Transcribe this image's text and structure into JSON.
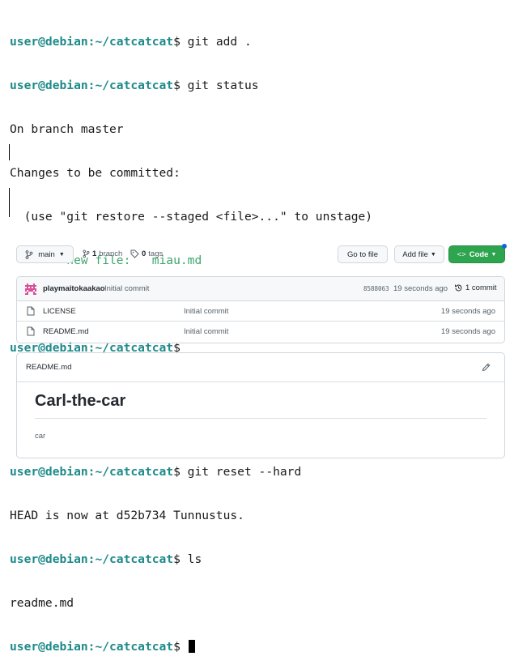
{
  "terminal": {
    "user_host": "user@debian",
    "path": ":~/catcatcat",
    "prompt_sign": "$",
    "lines": {
      "cmd1": " git add .",
      "cmd2": " git status",
      "out1": "On branch master",
      "out2": "Changes to be committed:",
      "out3": "  (use \"git restore --staged <file>...\" to unstage)",
      "out4": "        new file:   miau.md",
      "cmd4": " git reset --hard",
      "out5": "HEAD is now at d52b734 Tunnustus.",
      "cmd5": " ls",
      "out6": "readme.md"
    }
  },
  "github": {
    "branch_button": "main",
    "branch_count": "1",
    "branch_label": "branch",
    "tag_count": "0",
    "tag_label": "tags",
    "go_to_file": "Go to file",
    "add_file": "Add file",
    "code": "Code",
    "commit": {
      "author": "playmaitokaakao",
      "message": "Initial commit",
      "hash": "8588063",
      "time": "19 seconds ago",
      "count": "1 commit"
    },
    "files": [
      {
        "name": "LICENSE",
        "message": "Initial commit",
        "time": "19 seconds ago"
      },
      {
        "name": "README.md",
        "message": "Initial commit",
        "time": "19 seconds ago"
      }
    ],
    "readme": {
      "filename": "README.md",
      "heading": "Carl-the-car",
      "body": "car"
    },
    "colors": {
      "code_button": "#2da44e",
      "prompt": "#1e8a8a",
      "staged_file": "#3fa66e"
    }
  }
}
